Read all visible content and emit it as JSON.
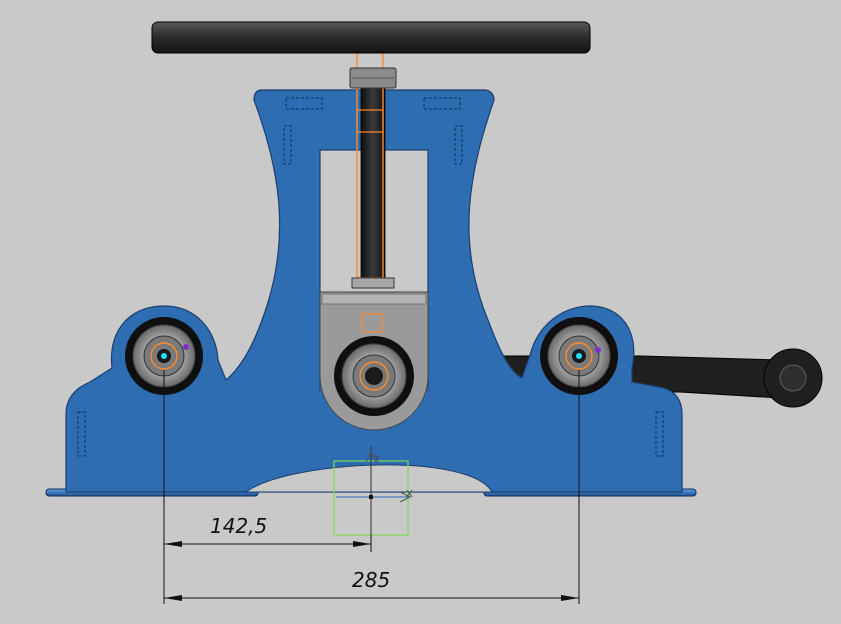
{
  "colors": {
    "background": "#c9c9c9",
    "frame_blue": "#2f6db3",
    "frame_edge": "#1b3f6e",
    "handle_dark": "#2b2b2b",
    "slider_gray": "#9a9a9a",
    "highlight_orange": "#ff8a2a",
    "sketch_green": "#7ed957",
    "center_cyan": "#22e0ff",
    "dimension_black": "#111111"
  },
  "dimensions": {
    "half_span": "142,5",
    "full_span": "285"
  },
  "axis": {
    "x_label": "X",
    "y_label": "Y"
  }
}
